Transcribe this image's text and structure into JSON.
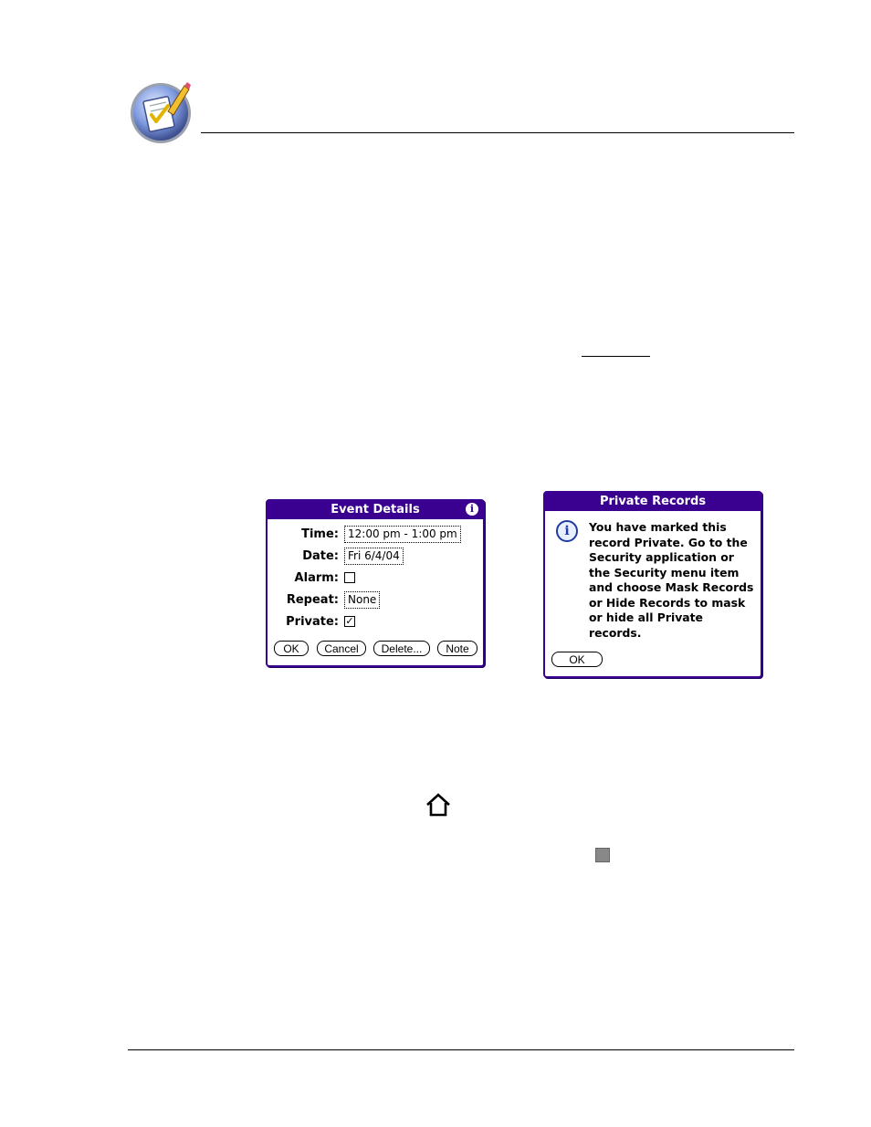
{
  "icons": {
    "logo": "datebook-checklist-pencil-icon",
    "home": "home-icon",
    "info": "info-icon",
    "small_square": "grey-square-icon"
  },
  "colors": {
    "palm_title": "#3a008f",
    "info_icon": "#1f3aa0"
  },
  "event_details": {
    "title": "Event Details",
    "info_glyph": "i",
    "fields": [
      {
        "label": "Time:",
        "value": "12:00 pm - 1:00 pm"
      },
      {
        "label": "Date:",
        "value": "Fri 6/4/04"
      },
      {
        "label": "Alarm:",
        "checked": false
      },
      {
        "label": "Repeat:",
        "value": "None"
      },
      {
        "label": "Private:",
        "checked": true
      }
    ],
    "buttons": [
      "OK",
      "Cancel",
      "Delete...",
      "Note"
    ],
    "check_glyph": "✓"
  },
  "private_records": {
    "title": "Private Records",
    "info_glyph": "i",
    "message": "You have marked this record Private. Go to the Security application or the Security menu item and choose Mask Records or Hide Records to mask or hide all Private records.",
    "ok_label": "OK"
  }
}
